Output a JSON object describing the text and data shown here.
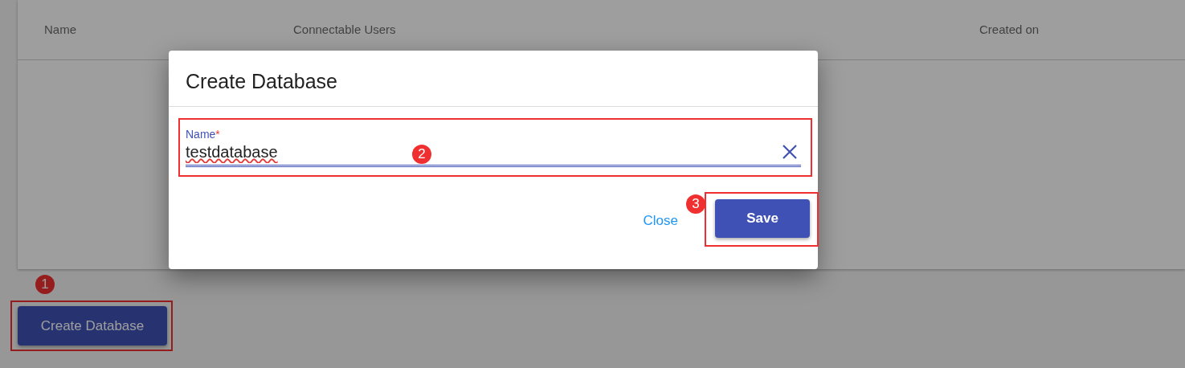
{
  "table": {
    "columns": [
      "Name",
      "Connectable Users",
      "Created on"
    ]
  },
  "create_button": {
    "label": "Create Database"
  },
  "dialog": {
    "title": "Create Database",
    "field": {
      "label": "Name",
      "required_mark": "*",
      "value": "testdatabase"
    },
    "close_label": "Close",
    "save_label": "Save"
  },
  "annotations": [
    {
      "label": "1",
      "kind": "button"
    },
    {
      "label": "2",
      "kind": "field"
    },
    {
      "label": "3",
      "kind": "save"
    }
  ]
}
